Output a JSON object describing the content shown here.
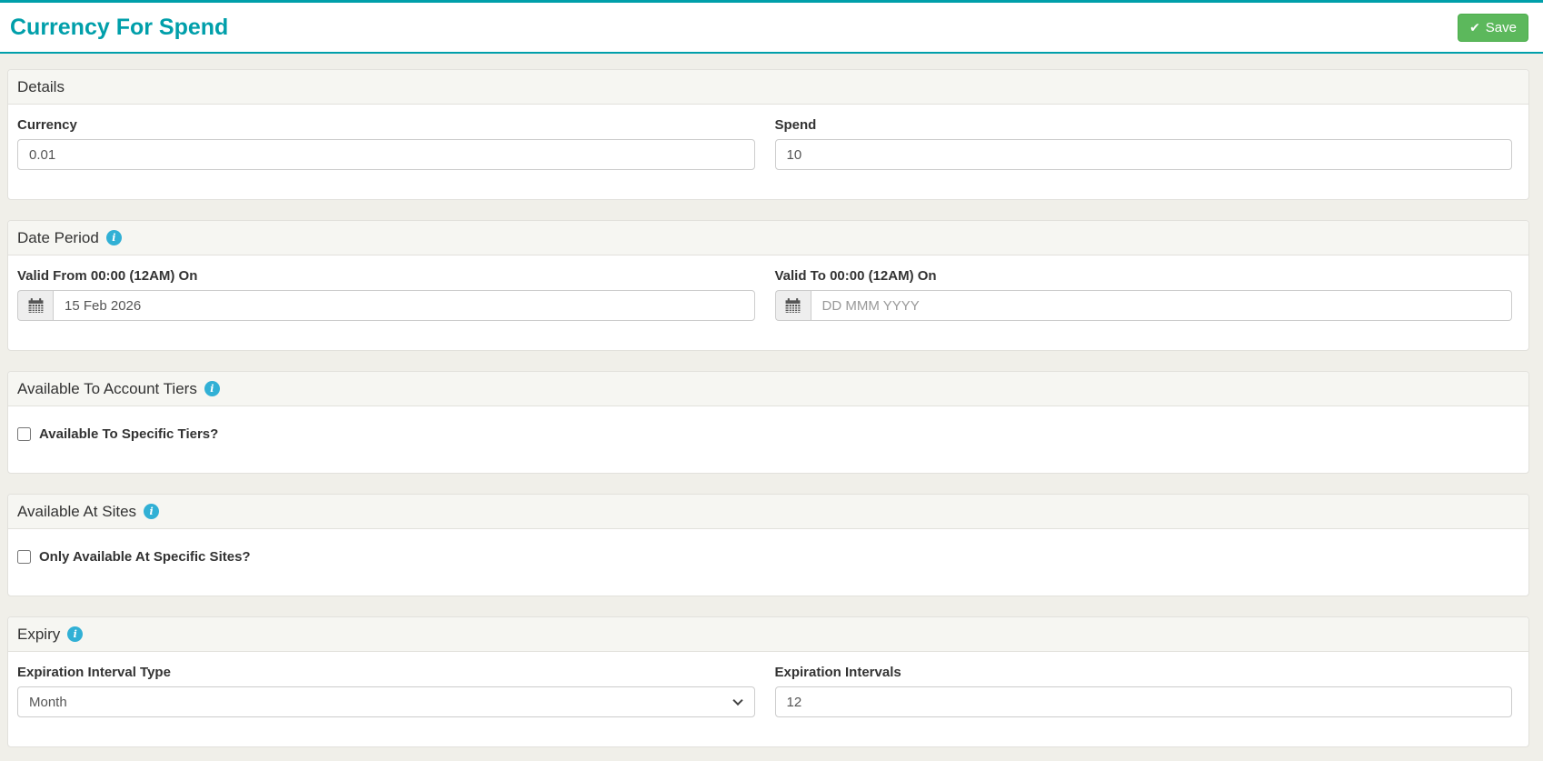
{
  "header": {
    "title": "Currency For Spend",
    "save_button": {
      "label": "Save",
      "icon_glyph": "✔"
    }
  },
  "sections": {
    "details": {
      "title": "Details",
      "currency": {
        "label": "Currency",
        "value": "0.01"
      },
      "spend": {
        "label": "Spend",
        "value": "10"
      }
    },
    "date_period": {
      "title": "Date Period",
      "valid_from": {
        "label": "Valid From 00:00 (12AM) On",
        "value": "15 Feb 2026"
      },
      "valid_to": {
        "label": "Valid To 00:00 (12AM) On",
        "value": "",
        "placeholder": "DD MMM YYYY"
      }
    },
    "account_tiers": {
      "title": "Available To Account Tiers",
      "checkbox_label": "Available To Specific Tiers?",
      "checked": false
    },
    "sites": {
      "title": "Available At Sites",
      "checkbox_label": "Only Available At Specific Sites?",
      "checked": false
    },
    "expiry": {
      "title": "Expiry",
      "interval_type": {
        "label": "Expiration Interval Type",
        "value": "Month"
      },
      "intervals": {
        "label": "Expiration Intervals",
        "value": "12"
      }
    }
  },
  "icons": {
    "info": "i"
  },
  "colors": {
    "accent": "#009faa",
    "save_green": "#5cb85c",
    "info_blue": "#31b0d5",
    "page_bg": "#f0efe9"
  }
}
